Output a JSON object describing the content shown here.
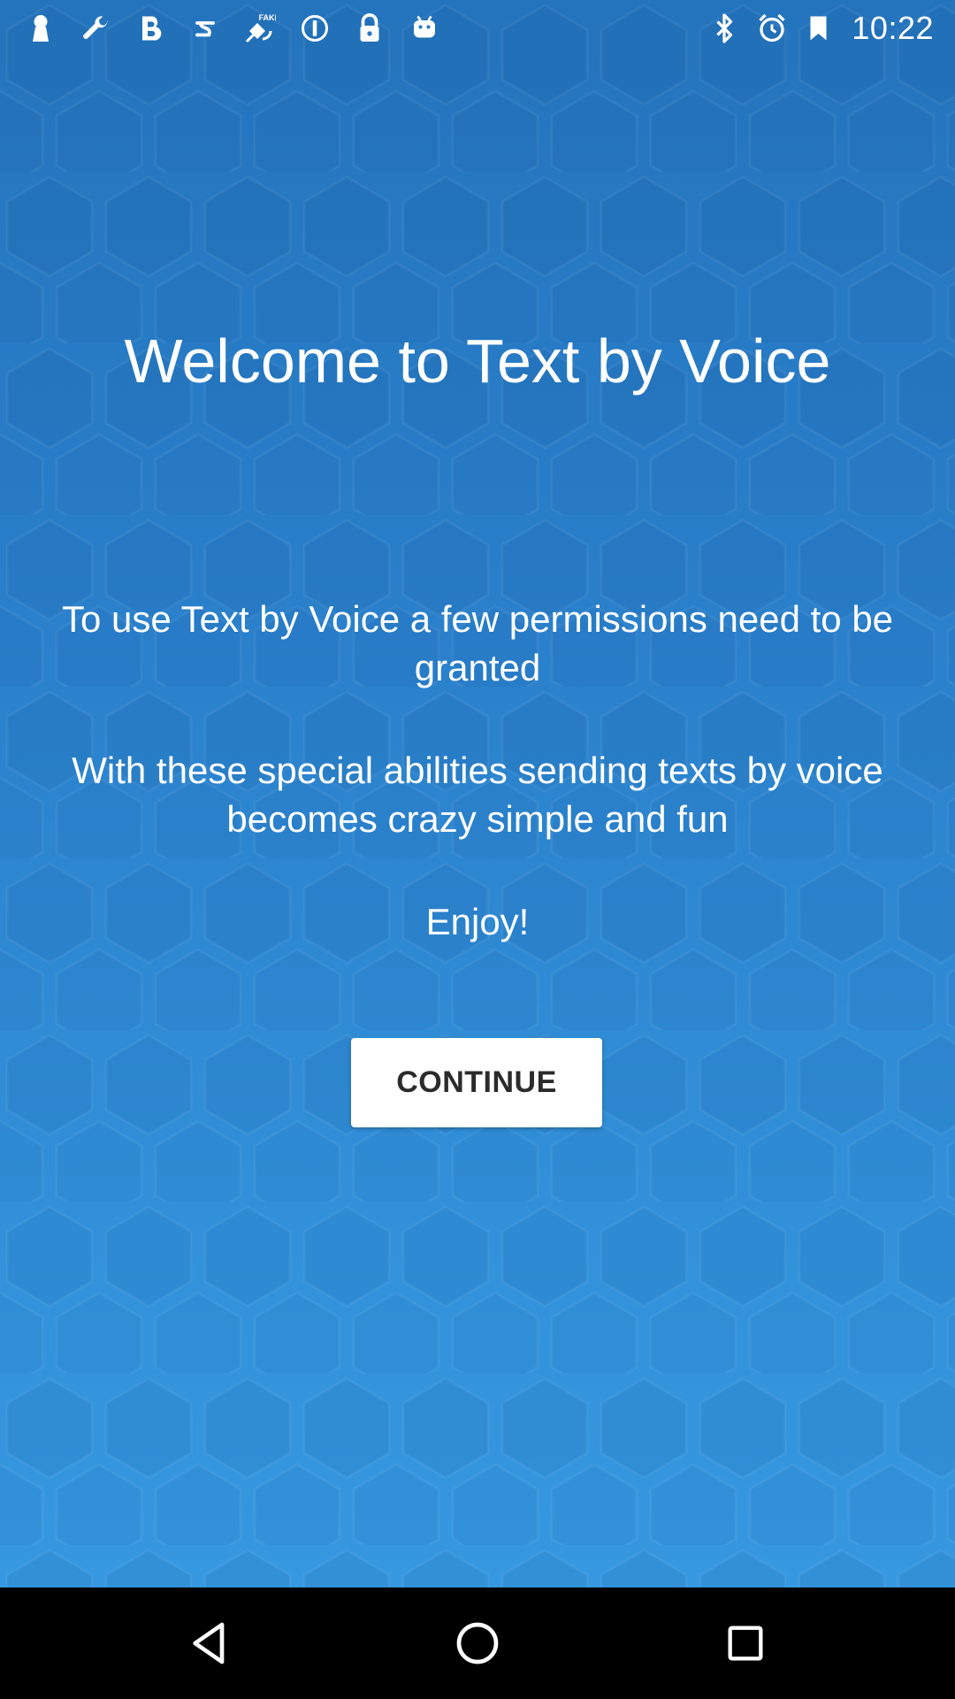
{
  "status_bar": {
    "time": "10:22",
    "left_icons": [
      "keyhole-icon",
      "wrench-icon",
      "bold-b-icon",
      "s-swirl-icon",
      "fake-gps-satellite-icon",
      "info-circle-icon",
      "lock-icon",
      "android-robot-icon"
    ],
    "right_icons": [
      "bluetooth-icon",
      "alarm-icon",
      "signal-icon"
    ],
    "fake_badge": "FAKE"
  },
  "welcome": {
    "title": "Welcome to Text by Voice",
    "permissions_text": "To use Text by Voice a few permissions need to be granted",
    "abilities_text": "With these special abilities sending texts by voice becomes crazy simple and fun",
    "enjoy_text": "Enjoy!",
    "continue_label": "CONTINUE"
  },
  "nav_bar": {
    "icons": [
      "back-icon",
      "home-icon",
      "recents-icon"
    ]
  },
  "colors": {
    "background_top": "#2474bd",
    "background_bottom": "#3698e0",
    "button_bg": "#ffffff",
    "button_text": "#2b2b2b"
  }
}
